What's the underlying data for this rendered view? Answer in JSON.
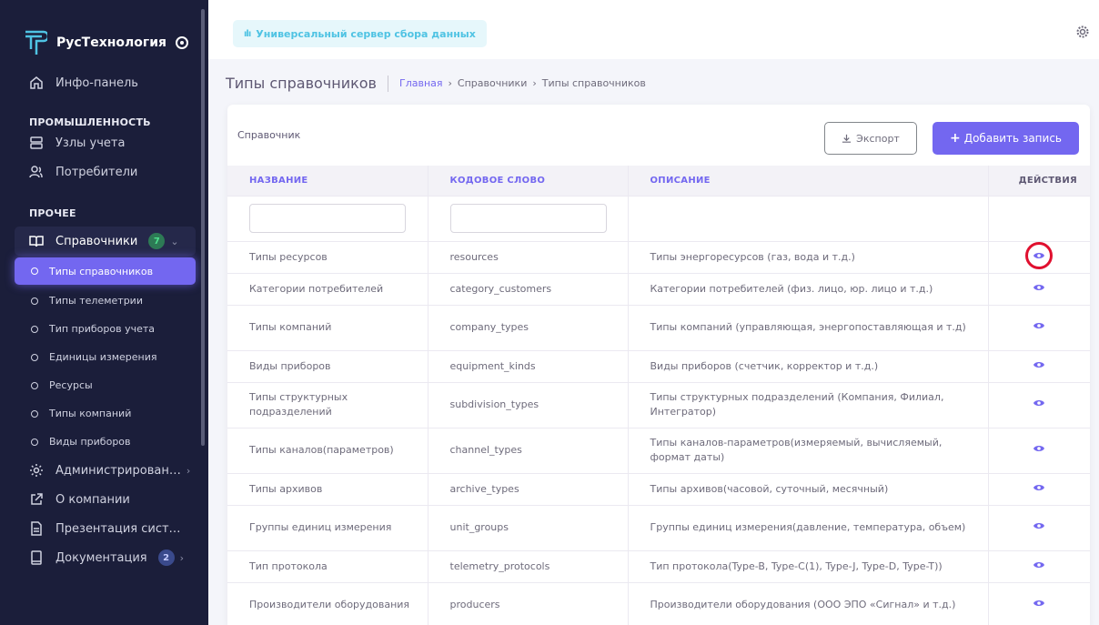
{
  "brand": {
    "name": "РусТехнология"
  },
  "sidebar": {
    "dashboard": "Инфо-панель",
    "section_industry": "ПРОМЫШЛЕННОСТЬ",
    "meters": "Узлы учета",
    "consumers": "Потребители",
    "section_other": "ПРОЧЕЕ",
    "references": {
      "label": "Справочники",
      "badge": "7"
    },
    "sub_items": [
      "Типы справочников",
      "Типы телеметрии",
      "Тип приборов учета",
      "Единицы измерения",
      "Ресурсы",
      "Типы компаний",
      "Виды приборов"
    ],
    "admin": "Администрирован…",
    "about": "О компании",
    "presentation": "Презентация сист…",
    "docs": {
      "label": "Документация",
      "badge": "2"
    }
  },
  "topbar": {
    "server": "Универсальный сервер сбора данных"
  },
  "page": {
    "title": "Типы справочников",
    "crumb_home": "Главная",
    "crumb_refs": "Справочники",
    "crumb_current": "Типы справочников"
  },
  "card": {
    "title": "Справочник",
    "export_label": "Экспорт",
    "add_label": "Добавить запись"
  },
  "table": {
    "headers": [
      "НАЗВАНИЕ",
      "КОДОВОЕ СЛОВО",
      "ОПИСАНИЕ",
      "ДЕЙСТВИЯ"
    ],
    "rows": [
      [
        "Типы ресурсов",
        "resources",
        "Типы энергоресурсов (газ, вода и т.д.)"
      ],
      [
        "Категории потребителей",
        "category_customers",
        "Категории потребителей (физ. лицо, юр. лицо и т.д.)"
      ],
      [
        "Типы компаний",
        "company_types",
        "Типы компаний (управляющая, энергопоставляющая и т.д)"
      ],
      [
        "Виды приборов",
        "equipment_kinds",
        "Виды приборов (счетчик, корректор и т.д.)"
      ],
      [
        "Типы структурных подразделений",
        "subdivision_types",
        "Типы структурных подразделений (Компания, Филиал, Интегратор)"
      ],
      [
        "Типы каналов(параметров)",
        "channel_types",
        "Типы каналов-параметров(измеряемый, вычисляемый, формат даты)"
      ],
      [
        "Типы архивов",
        "archive_types",
        "Типы архивов(часовой, суточный, месячный)"
      ],
      [
        "Группы единиц измерения",
        "unit_groups",
        "Группы единиц измерения(давление, температура, объем)"
      ],
      [
        "Тип протокола",
        "telemetry_protocols",
        "Тип протокола(Type-B, Type-C(1), Type-J, Type-D, Type-T))"
      ],
      [
        "Производители оборудования",
        "producers",
        "Производители оборудования (ООО ЭПО «Сигнал» и т.д.)"
      ]
    ]
  },
  "colors": {
    "accent": "#7367f0",
    "sidebar_bg": "#1b1e3a",
    "highlight": "#e0102f"
  }
}
